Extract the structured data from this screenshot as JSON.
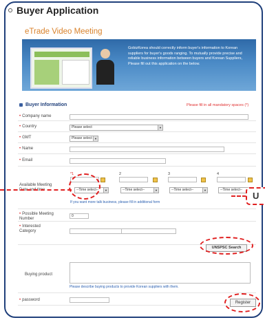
{
  "page": {
    "title": "Buyer Application",
    "subtitle": "eTrade Video Meeting"
  },
  "banner": {
    "text": "GobizKorea should correctly inform buyer's information to Korean suppliers for buyer's goods ranging. To mutually provide precise and reliable business information between buyers and Korean Suppliers, Please fill out this application on the below."
  },
  "section": {
    "title": "Buyer Information",
    "mandatory_note": "Please fill in all mandatory spaces (*)"
  },
  "fields": {
    "company_name": "Company name",
    "country": "Country",
    "country_select": "Please select",
    "gmt": "GMT",
    "gmt_select": "Please select",
    "name": "Name",
    "email": "Email",
    "meeting_label": "Available Meeting Date and time",
    "slot_labels": [
      "*1",
      "2",
      "3",
      "4"
    ],
    "time_select": "--Time select--",
    "meeting_help": "If you want more talk business, please fill in additional form",
    "possible_meeting_label": "Possible Meeting Number",
    "possible_meeting_value": "0",
    "interested_label": "Interested Category",
    "unspsc_button": "UNSPSC Search",
    "buying_label": "Buying product",
    "buying_help": "Please describe buying products to provide Korean suppliers with them.",
    "password": "password",
    "register_button": "Register"
  },
  "zoom_callout": {
    "text": "U"
  },
  "colors": {
    "frame": "#1f3f7a",
    "accent_orange": "#d9822b",
    "required_red": "#d22222",
    "link_blue": "#2a5fb0",
    "callout_red": "#e02020"
  }
}
